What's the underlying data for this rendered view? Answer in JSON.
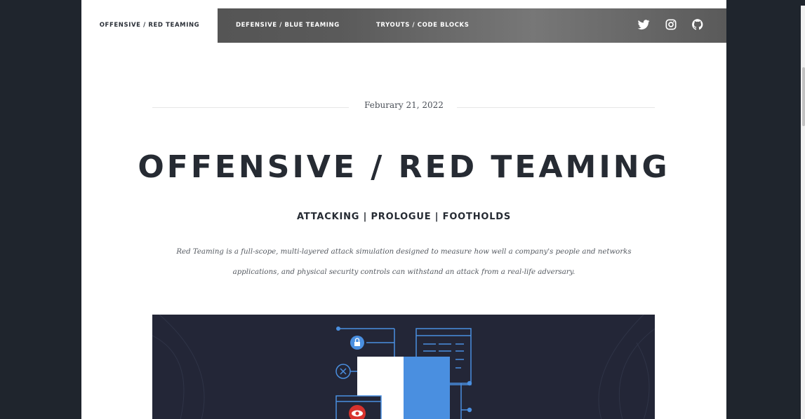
{
  "nav": {
    "tabs": [
      {
        "label": "OFFENSIVE / RED TEAMING",
        "active": true
      },
      {
        "label": "DEFENSIVE / BLUE TEAMING",
        "active": false
      },
      {
        "label": "TRYOUTS / CODE BLOCKS",
        "active": false
      }
    ],
    "social_icons": [
      "twitter-icon",
      "instagram-icon",
      "github-icon"
    ]
  },
  "post": {
    "date": "Feburary 21, 2022",
    "title": "OFFENSIVE / RED TEAMING",
    "subtitle": "ATTACKING | PROLOGUE | FOOTHOLDS",
    "description": "Red Teaming is a full-scope, multi-layered attack simulation designed to measure how well a company's people and networks applications, and physical security controls can withstand an attack from a real-life adversary."
  },
  "colors": {
    "hero_bg": "#232637",
    "accent_blue": "#4a8fe0",
    "alert_red": "#d8322d",
    "text_dark": "#262b33"
  }
}
